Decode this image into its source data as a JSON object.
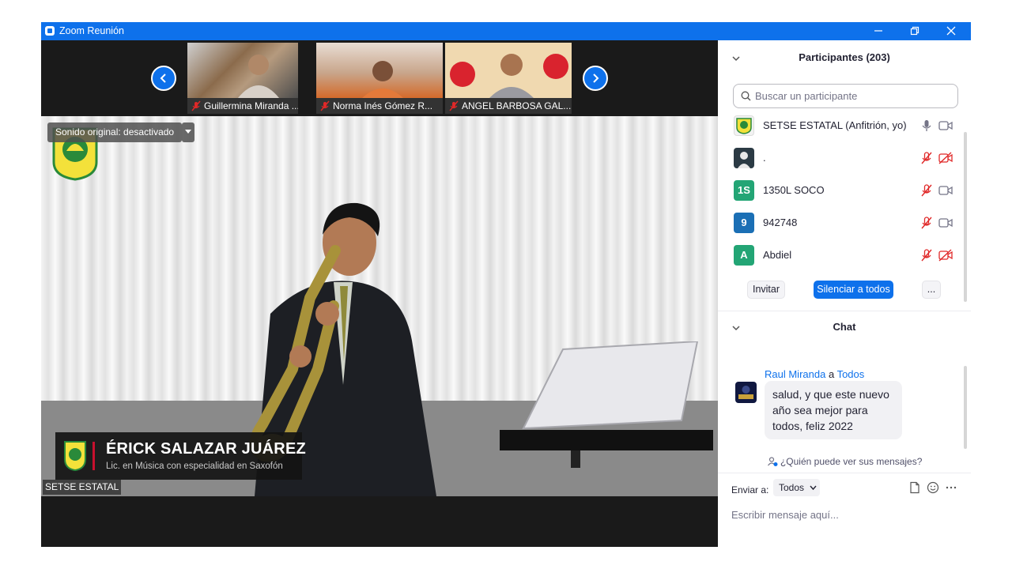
{
  "window": {
    "title": "Zoom Reunión"
  },
  "strip": {
    "thumbnails": [
      {
        "name": "Guillermina Miranda ..."
      },
      {
        "name": "Norma Inés Gómez R..."
      },
      {
        "name": "ANGEL BARBOSA GAL..."
      }
    ]
  },
  "main_video": {
    "original_sound": "Sonido original: desactivado",
    "lower_third_name": "ÉRICK SALAZAR JUÁREZ",
    "lower_third_subtitle": "Lic. en Música con especialidad en Saxofón",
    "speaker_name": "SETSE ESTATAL"
  },
  "participants": {
    "header": "Participantes (203)",
    "search_placeholder": "Buscar un participante",
    "list": [
      {
        "name": "SETSE ESTATAL (Anfitrión, yo)",
        "initials": "",
        "avatar_color": "#f2f2f2",
        "mic": "on",
        "cam": "on"
      },
      {
        "name": ".",
        "initials": "",
        "avatar_color": "#2b3a44",
        "mic": "muted",
        "cam": "off"
      },
      {
        "name": "1350L SOCO",
        "initials": "1S",
        "avatar_color": "#23a575",
        "mic": "muted",
        "cam": "on"
      },
      {
        "name": "942748",
        "initials": "9",
        "avatar_color": "#1b6fb5",
        "mic": "muted",
        "cam": "on"
      },
      {
        "name": "Abdiel",
        "initials": "A",
        "avatar_color": "#23a575",
        "mic": "muted",
        "cam": "off"
      }
    ],
    "invite_label": "Invitar",
    "mute_all_label": "Silenciar a todos",
    "more_label": "..."
  },
  "chat": {
    "header": "Chat",
    "message_from": "Raul Miranda",
    "message_to_prefix": "a",
    "message_to": "Todos",
    "message_text": "salud, y que este nuevo año sea mejor para todos, feliz 2022",
    "who_can_see": "¿Quién puede ver sus mensajes?",
    "send_to_label": "Enviar a:",
    "send_to_value": "Todos",
    "input_placeholder": "Escribir mensaje aquí..."
  },
  "colors": {
    "accent": "#0e71eb",
    "muted_red": "#e02828",
    "title_bar": "#0e71eb"
  }
}
